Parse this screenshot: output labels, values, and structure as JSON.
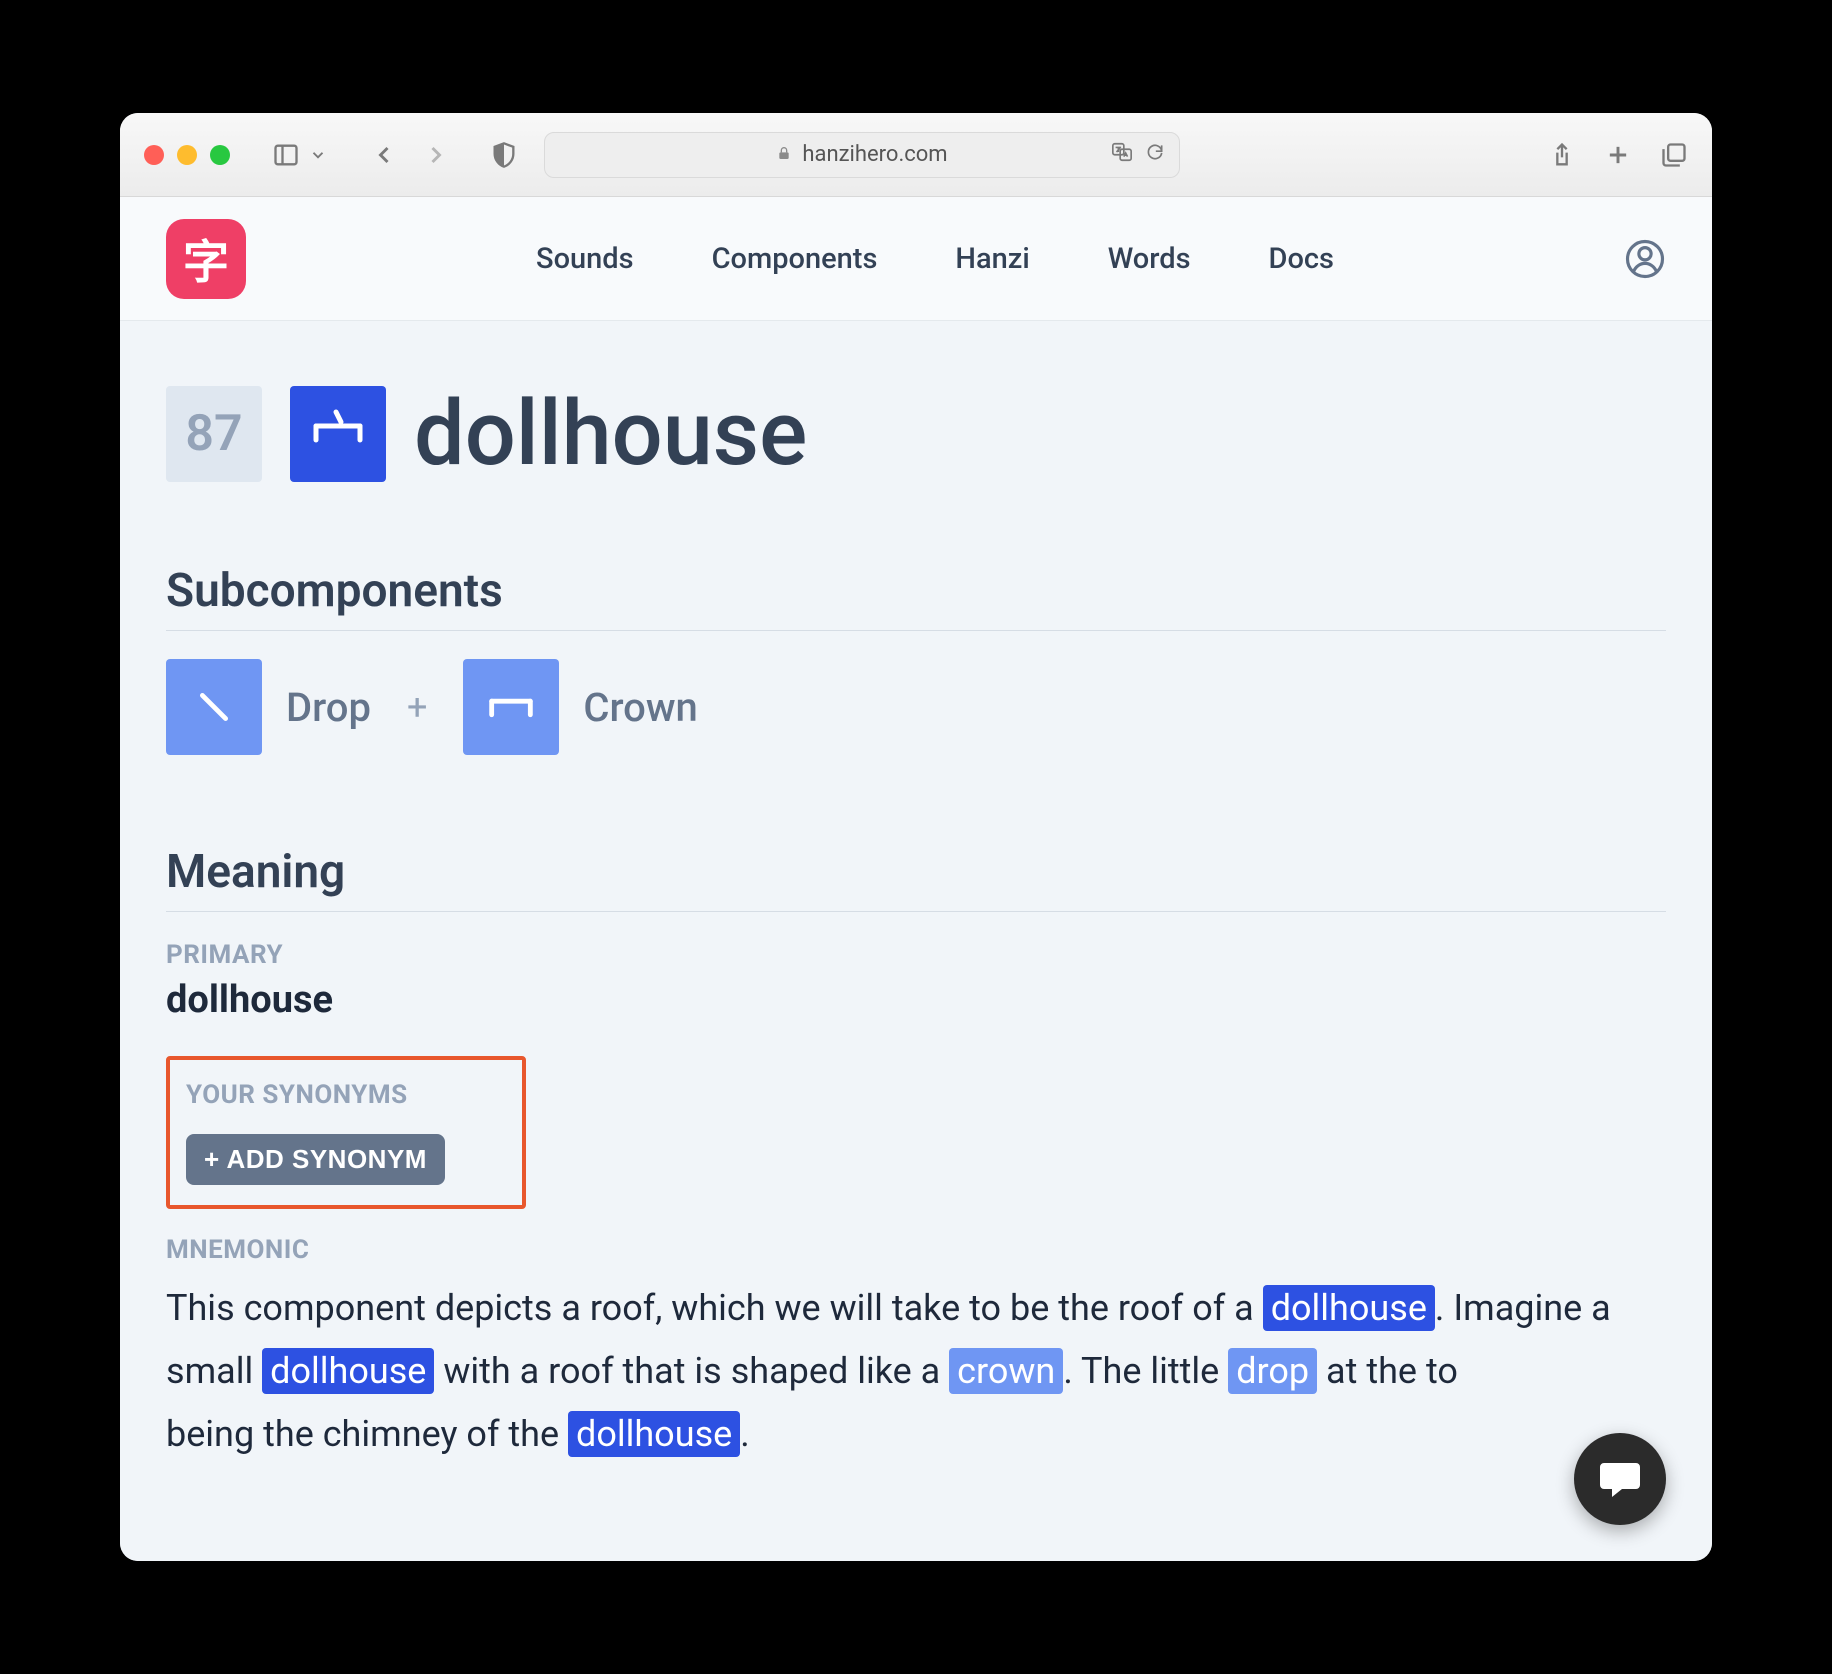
{
  "browser": {
    "url": "hanzihero.com"
  },
  "header": {
    "logo_char": "字",
    "nav": [
      "Sounds",
      "Components",
      "Hanzi",
      "Words",
      "Docs"
    ]
  },
  "page": {
    "number": "87",
    "title": "dollhouse"
  },
  "subcomponents": {
    "heading": "Subcomponents",
    "items": [
      {
        "label": "Drop"
      },
      {
        "label": "Crown"
      }
    ],
    "plus": "+"
  },
  "meaning": {
    "heading": "Meaning",
    "primary_label": "PRIMARY",
    "primary_value": "dollhouse",
    "synonyms_label": "YOUR SYNONYMS",
    "add_synonym_button": "+ ADD SYNONYM",
    "mnemonic_label": "MNEMONIC",
    "mnemonic": {
      "p1": "This component depicts a roof, which we will take to be the roof of a ",
      "h1": "dollhouse",
      "p2": ". Imagine a small ",
      "h2": "dollhouse",
      "p3": " with a roof that is shaped like a ",
      "h3": "crown",
      "p4": ". The little ",
      "h4": "drop",
      "p5": " at the to",
      "p6": "being the chimney of the ",
      "h5": "dollhouse",
      "p7": "."
    }
  }
}
